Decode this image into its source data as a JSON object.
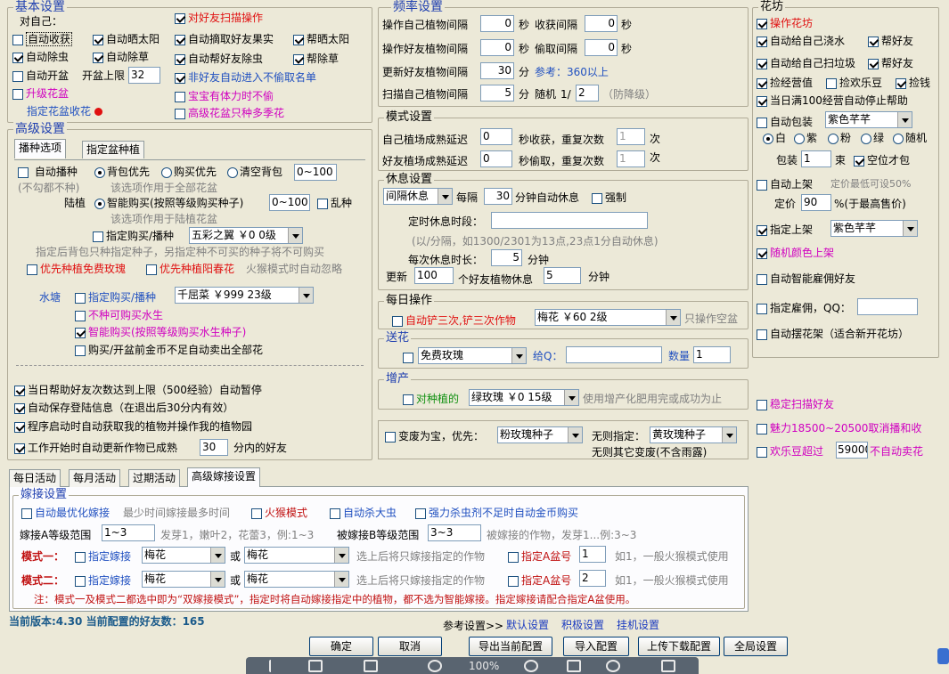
{
  "basic": {
    "title": "基本设置",
    "self_label": "对自己：",
    "items": [
      {
        "label": "自动收获",
        "on": false
      },
      {
        "label": "自动晒太阳",
        "on": true
      },
      {
        "label": "自动除虫",
        "on": true
      },
      {
        "label": "自动除草",
        "on": true
      },
      {
        "label": "自动开盆",
        "on": false
      },
      {
        "label": "升级花盆",
        "on": false
      }
    ],
    "pot_limit_label": "开盆上限",
    "pot_limit_value": "32",
    "specify_pot_label": "指定花盆收花",
    "friend_items": [
      {
        "label": "对好友扫描操作",
        "on": true
      },
      {
        "label": "自动摘取好友果实",
        "on": true
      },
      {
        "label": "帮晒太阳",
        "on": true
      },
      {
        "label": "自动帮好友除虫",
        "on": true
      },
      {
        "label": "帮除草",
        "on": true
      },
      {
        "label": "非好友自动进入不偷取名单",
        "on": true
      },
      {
        "label": "宝宝有体力时不偷",
        "on": false
      },
      {
        "label": "高级花盆只种多季花",
        "on": false
      }
    ]
  },
  "advanced": {
    "title": "高级设置",
    "tabs": [
      "播种选项",
      "指定盆种植"
    ],
    "auto_sow": "自动播种",
    "no_tick_note": "(不勾都不种)",
    "bag_first": "背包优先",
    "buy_first": "购买优先",
    "clear_bag": "清空背包",
    "sow_range": "0~100",
    "sow_note": "该选项作用于全部花盆",
    "land_label": "陆植",
    "smart_buy": "智能购买(按照等级购买种子)",
    "smart_range": "0~100",
    "random_sow": "乱种",
    "land_note": "该选项作用于陆植花盆",
    "specify_buy": "指定购买/播种",
    "specify_seed": "五彩之翼 ￥0 0级",
    "specify_note": "指定后背包只种指定种子，另指定种不可买的种子将不可购买",
    "priority_rose": "优先种植免费玫瑰",
    "priority_sun": "优先种植阳春花",
    "fire_ignore": "火猴模式时自动忽略",
    "pond_label": "水塘",
    "pond_specify": "指定购买/播种",
    "pond_seed": "千屈菜 ￥999 23级",
    "pond_no_buy": "不种可购买水生",
    "pond_smart": "智能购买(按照等级购买水生种子)",
    "pond_sell": "购买/开盆前金币不足自动卖出全部花",
    "bottom": [
      {
        "label": "当日帮助好友次数达到上限（500经验）自动暂停",
        "on": true
      },
      {
        "label": "自动保存登陆信息（在退出后30分内有效）",
        "on": true
      },
      {
        "label": "程序启动时自动获取我的植物并操作我的植物园",
        "on": true
      },
      {
        "label": "工作开始时自动更新作物已成熟",
        "on": true
      }
    ],
    "update_minutes": "30",
    "update_suffix": "分内的好友"
  },
  "freq": {
    "title": "频率设置",
    "own_interval": "操作自己植物间隔",
    "own_val": "0",
    "own_unit": "秒",
    "harvest_interval": "收获间隔",
    "harvest_val": "0",
    "harvest_unit": "秒",
    "friend_interval": "操作好友植物间隔",
    "friend_val": "0",
    "friend_unit": "秒",
    "steal_interval": "偷取间隔",
    "steal_val": "0",
    "steal_unit": "秒",
    "update_interval": "更新好友植物间隔",
    "update_val": "30",
    "update_unit": "分",
    "ref_note": "参考：360以上",
    "scan_interval": "扫描自己植物间隔",
    "scan_val": "5",
    "scan_unit": "分",
    "random_label": "随机",
    "random_frac": "1/",
    "random_val": "2",
    "anti_drop": "（防降级）"
  },
  "mode": {
    "title": "模式设置",
    "own_delay": "自己植场成熟延迟",
    "own_delay_val": "0",
    "own_delay_mid": "秒收获，重复次数",
    "own_delay_rep": "1",
    "unit_times": "次",
    "friend_delay": "好友植场成熟延迟",
    "friend_delay_val": "0",
    "friend_delay_mid": "秒偷取，重复次数",
    "friend_delay_rep": "1"
  },
  "rest": {
    "title": "休息设置",
    "mode": "间隔休息",
    "every": "每隔",
    "every_val": "30",
    "auto_rest": "分钟自动休息",
    "force": "强制",
    "timed_label": "定时休息时段：",
    "timed_note": "(以/分隔，如1300/2301为13点,23点1分自动休息)",
    "duration_label": "每次休息时长：",
    "duration_val": "5",
    "duration_unit": "分钟",
    "update_label": "更新",
    "update_val": "100",
    "update_mid": "个好友植物休息",
    "update_val2": "5",
    "update_unit": "分钟"
  },
  "daily": {
    "title": "每日操作",
    "shovel": "自动铲三次,铲三次作物",
    "shovel_seed": "梅花 ￥60 2级",
    "only_empty": "只操作空盆"
  },
  "gift": {
    "title": "送花",
    "flower": "免费玫瑰",
    "to_q": "给Q：",
    "qty": "数量",
    "qty_val": "1"
  },
  "boost": {
    "title": "增产",
    "target": "对种植的",
    "seed": "绿玫瑰 ￥0 15级",
    "note": "使用增产化肥用完或成功为止"
  },
  "mutate": {
    "label": "变废为宝，优先：",
    "first": "粉玫瑰种子",
    "none_label": "无则指定：",
    "second": "黄玫瑰种子",
    "none_other": "无则其它变废(不含雨露)"
  },
  "shop": {
    "title": "花坊",
    "operate": "操作花坊",
    "items": [
      {
        "label": "自动给自己浇水",
        "on": true
      },
      {
        "label": "帮好友",
        "on": true
      },
      {
        "label": "自动给自己扫垃圾",
        "on": true
      },
      {
        "label": "帮好友",
        "on": true
      },
      {
        "label": "捡经营值",
        "on": true
      },
      {
        "label": "捡欢乐豆",
        "on": false
      },
      {
        "label": "捡钱",
        "on": true
      },
      {
        "label": "当日满100经营自动停止帮助",
        "on": true
      }
    ],
    "auto_pack": "自动包装",
    "pack_flower": "紫色芊芊",
    "colors": [
      "白",
      "紫",
      "粉",
      "绿",
      "随机"
    ],
    "pack_label": "包装",
    "pack_val": "1",
    "bundle": "束",
    "only_empty": "空位才包",
    "auto_shelf": "自动上架",
    "min_price_note": "定价最低可设50%",
    "price_label": "定价",
    "price_val": "90",
    "price_note": "%(于最高售价)",
    "specify_shelf": "指定上架",
    "shelf_flower": "紫色芊芊",
    "random_color": "随机颜色上架",
    "smart_hire": "自动智能雇佣好友",
    "specify_hire": "指定雇佣，QQ：",
    "auto_rack": "自动摆花架（适合新开花坊）",
    "stable_scan": "稳定扫描好友",
    "charm": "魅力18500~20500取消播和收",
    "happy_bean": "欢乐豆超过",
    "happy_val": "59000",
    "no_sell": "不自动卖花"
  },
  "bottom_tabs": [
    "每日活动",
    "每月活动",
    "过期活动",
    "高级嫁接设置"
  ],
  "graft": {
    "title": "嫁接设置",
    "auto_opt": "自动最优化嫁接",
    "opt_note": "最少时间嫁接最多时间",
    "fire": "火猴模式",
    "kill_bug": "自动杀大虫",
    "strong_kill": "强力杀虫剂不足时自动金币购买",
    "a_range_label": "嫁接A等级范围",
    "a_range": "1~3",
    "a_note": "发芽1，嫩叶2，花蕾3，例:1~3",
    "b_range_label": "被嫁接B等级范围",
    "b_range": "3~3",
    "b_note": "被嫁接的作物，发芽1...例:3~3",
    "mode1": "模式一：",
    "mode2": "模式二：",
    "specify": "指定嫁接",
    "flower1": "梅花",
    "or": "或",
    "flower2": "梅花",
    "only_note": "选上后将只嫁接指定的作物",
    "specify_a": "指定A盆号",
    "a1": "1",
    "a2": "2",
    "a_hint": "如1，一般火猴模式使用",
    "warning": "注：模式一及模式二都选中即为“双嫁接模式”，指定时将自动嫁接指定中的植物，都不选为智能嫁接。指定嫁接请配合指定A盆使用。"
  },
  "footer": {
    "version": "当前版本:4.30 当前配置的好友数：165",
    "ref_label": "参考设置>>",
    "links": [
      "默认设置",
      "积极设置",
      "挂机设置"
    ],
    "buttons": [
      "确定",
      "取消",
      "导出当前配置",
      "导入配置",
      "上传下载配置",
      "全局设置"
    ],
    "zoom": "100%"
  }
}
